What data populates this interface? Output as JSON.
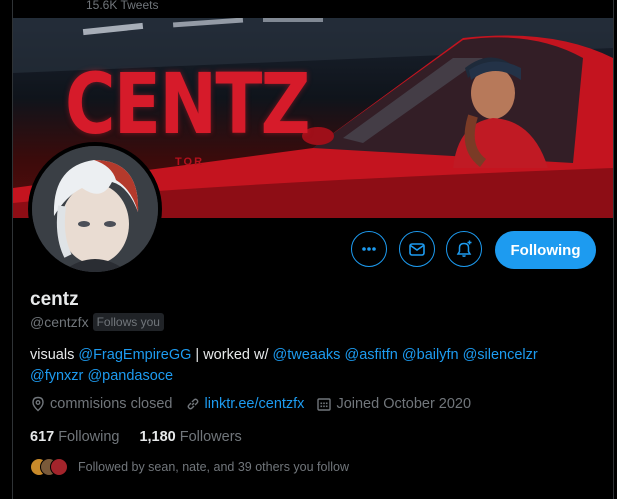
{
  "header": {
    "tweet_count": "15.6K Tweets"
  },
  "banner": {
    "word": "CENTZ",
    "subtitle": "TOR"
  },
  "actions": {
    "more_icon": "ellipsis-icon",
    "message_icon": "envelope-icon",
    "notify_icon": "bell-plus-icon",
    "following_label": "Following"
  },
  "profile": {
    "name": "centz",
    "handle": "@centzfx",
    "follows_you": "Follows you",
    "bio": {
      "text1": "visuals ",
      "mention1": "@FragEmpireGG",
      "text2": " | worked w/ ",
      "mention2": "@tweaaks",
      "mention3": "@asfitfn",
      "mention4": "@bailyfn",
      "mention5": "@silencelzr",
      "mention6": "@fynxzr",
      "mention7": "@pandasoce"
    },
    "location": "commisions closed",
    "link": "linktr.ee/centzfx",
    "joined": "Joined October 2020",
    "following_count": "617",
    "following_label": "Following",
    "followers_count": "1,180",
    "followers_label": "Followers",
    "followed_by": "Followed by sean, nate, and 39 others you follow"
  },
  "colors": {
    "accent": "#1d9bf0",
    "background": "#000000",
    "muted": "#71767b"
  }
}
